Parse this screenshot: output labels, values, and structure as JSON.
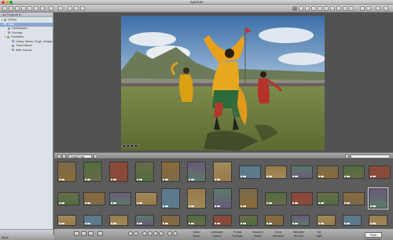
{
  "window": {
    "title": "Aperture",
    "traffic_colors": [
      "#e0443e",
      "#dea123",
      "#1aab29"
    ]
  },
  "sidebar": {
    "header": "All Projects ▾",
    "items": [
      {
        "label": "Library",
        "level": 0,
        "selected": false
      },
      {
        "label": "Yalta",
        "level": 0,
        "selected": true
      },
      {
        "label": "Landscapes",
        "level": 1,
        "selected": false
      },
      {
        "label": "Portraits",
        "level": 1,
        "selected": false
      },
      {
        "label": "Festivities",
        "level": 1,
        "selected": false
      },
      {
        "label": "Lhasa, Dance, Doge, Gadget",
        "level": 2,
        "selected": false
      },
      {
        "label": "Travel Album",
        "level": 2,
        "selected": false
      },
      {
        "label": "Web Journal",
        "level": 2,
        "selected": false
      }
    ]
  },
  "browser": {
    "sort_label": "Image Date",
    "search_placeholder": ""
  },
  "grid": {
    "selected_index": 25
  },
  "keywords": {
    "row1": [
      "Action",
      "Landscape",
      "Portrait",
      "Headshot",
      "Group",
      "Silhouette",
      "Bot"
    ],
    "row2": [
      "Indoor",
      "Outdoor",
      "Full Body",
      "Studio",
      "Interactive",
      "Red Eye",
      "Night"
    ]
  },
  "preset_label": "Photo Descriptions ▾",
  "status": {
    "text": "Stock"
  }
}
